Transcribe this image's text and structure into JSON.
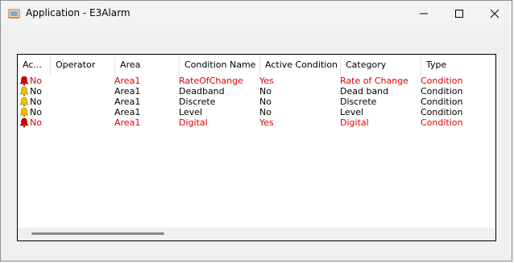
{
  "window": {
    "title": "Application - E3Alarm"
  },
  "columns": [
    "Ac...",
    "Operator",
    "Area",
    "Condition Name",
    "Active Condition",
    "Category",
    "Type"
  ],
  "rows": [
    {
      "ack": "No",
      "operator": "",
      "area": "Area1",
      "condition_name": "RateOfChange",
      "active": "Yes",
      "category": "Rate of Change",
      "type": "Condition",
      "state": "active",
      "icon": "red-bell-icon"
    },
    {
      "ack": "No",
      "operator": "",
      "area": "Area1",
      "condition_name": "Deadband",
      "active": "No",
      "category": "Dead band",
      "type": "Condition",
      "state": "inactive",
      "icon": "yellow-bell-icon"
    },
    {
      "ack": "No",
      "operator": "",
      "area": "Area1",
      "condition_name": "Discrete",
      "active": "No",
      "category": "Discrete",
      "type": "Condition",
      "state": "inactive",
      "icon": "yellow-bell-icon"
    },
    {
      "ack": "No",
      "operator": "",
      "area": "Area1",
      "condition_name": "Level",
      "active": "No",
      "category": "Level",
      "type": "Condition",
      "state": "inactive",
      "icon": "yellow-bell-icon"
    },
    {
      "ack": "No",
      "operator": "",
      "area": "Area1",
      "condition_name": "Digital",
      "active": "Yes",
      "category": "Digital",
      "type": "Condition",
      "state": "active",
      "icon": "red-bell-icon"
    }
  ],
  "colors": {
    "active_text": "#e00000",
    "inactive_text": "#000000",
    "red_bell": "#d40000",
    "yellow_bell": "#f2c200"
  }
}
